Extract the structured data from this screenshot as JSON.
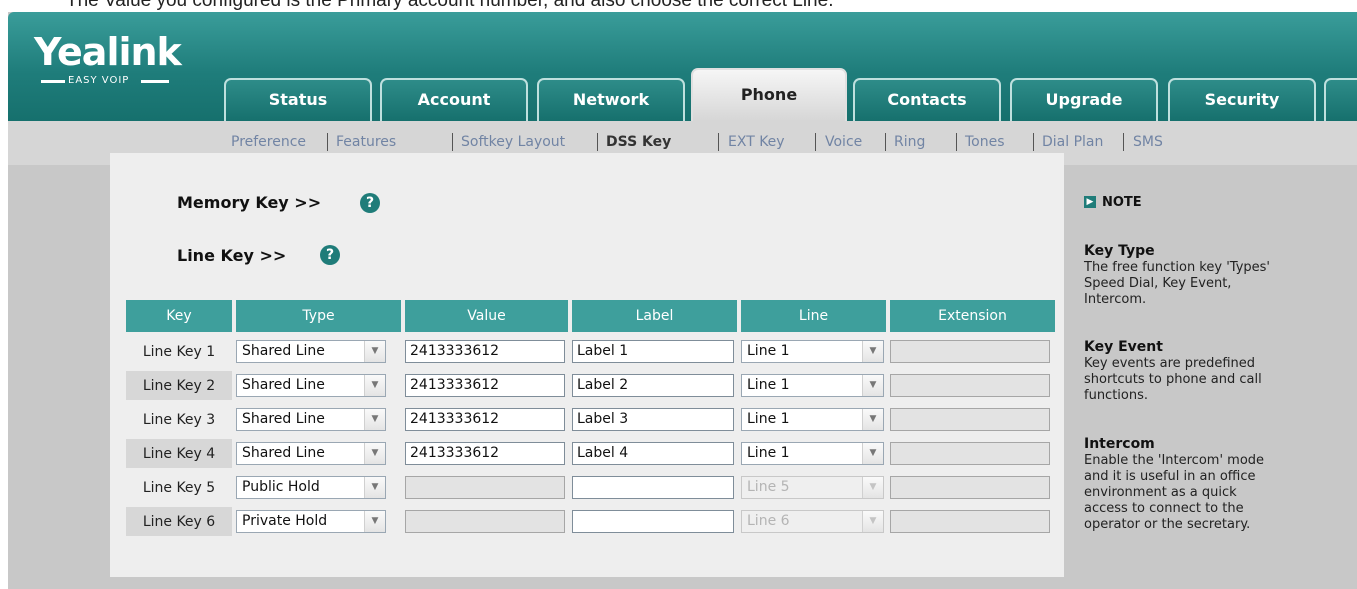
{
  "caption": "The Value you configured is the Primary account number, and also choose the correct Line.",
  "logo": {
    "text": "Yealink",
    "subtext": "EASY VOIP"
  },
  "tabs": [
    "Status",
    "Account",
    "Network",
    "Phone",
    "Contacts",
    "Upgrade",
    "Security"
  ],
  "active_tab": "Phone",
  "subnav": [
    "Preference",
    "Features",
    "Softkey Layout",
    "DSS Key",
    "EXT Key",
    "Voice",
    "Ring",
    "Tones",
    "Dial Plan",
    "SMS"
  ],
  "active_subnav": "DSS Key",
  "sections": {
    "memory_key": "Memory Key >>",
    "line_key": "Line Key >>",
    "help": "?"
  },
  "table": {
    "headers": [
      "Key",
      "Type",
      "Value",
      "Label",
      "Line",
      "Extension"
    ],
    "rows": [
      {
        "key": "Line Key 1",
        "type": "Shared Line",
        "value": "2413333612",
        "label": "Label 1",
        "line": "Line 1",
        "line_disabled": false,
        "value_disabled": false,
        "extension": ""
      },
      {
        "key": "Line Key 2",
        "type": "Shared Line",
        "value": "2413333612",
        "label": "Label 2",
        "line": "Line 1",
        "line_disabled": false,
        "value_disabled": false,
        "extension": ""
      },
      {
        "key": "Line Key 3",
        "type": "Shared Line",
        "value": "2413333612",
        "label": "Label 3",
        "line": "Line 1",
        "line_disabled": false,
        "value_disabled": false,
        "extension": ""
      },
      {
        "key": "Line Key 4",
        "type": "Shared Line",
        "value": "2413333612",
        "label": "Label 4",
        "line": "Line 1",
        "line_disabled": false,
        "value_disabled": false,
        "extension": ""
      },
      {
        "key": "Line Key 5",
        "type": "Public Hold",
        "value": "",
        "label": "",
        "line": "Line 5",
        "line_disabled": true,
        "value_disabled": true,
        "extension": ""
      },
      {
        "key": "Line Key 6",
        "type": "Private Hold",
        "value": "",
        "label": "",
        "line": "Line 6",
        "line_disabled": true,
        "value_disabled": true,
        "extension": ""
      }
    ]
  },
  "note": {
    "heading": "NOTE",
    "items": [
      {
        "title": "Key Type",
        "body": "The free function key 'Types' Speed Dial, Key Event, Intercom."
      },
      {
        "title": "Key Event",
        "body": "Key events are predefined shortcuts to phone and call functions."
      },
      {
        "title": "Intercom",
        "body": "Enable the 'Intercom' mode and it is useful in an office environment as a quick access to connect to the operator or the secretary."
      }
    ]
  },
  "colors": {
    "brand": "#1f7d7b",
    "header_cell": "#3e9f9c",
    "subnav_link": "#7184a4"
  }
}
